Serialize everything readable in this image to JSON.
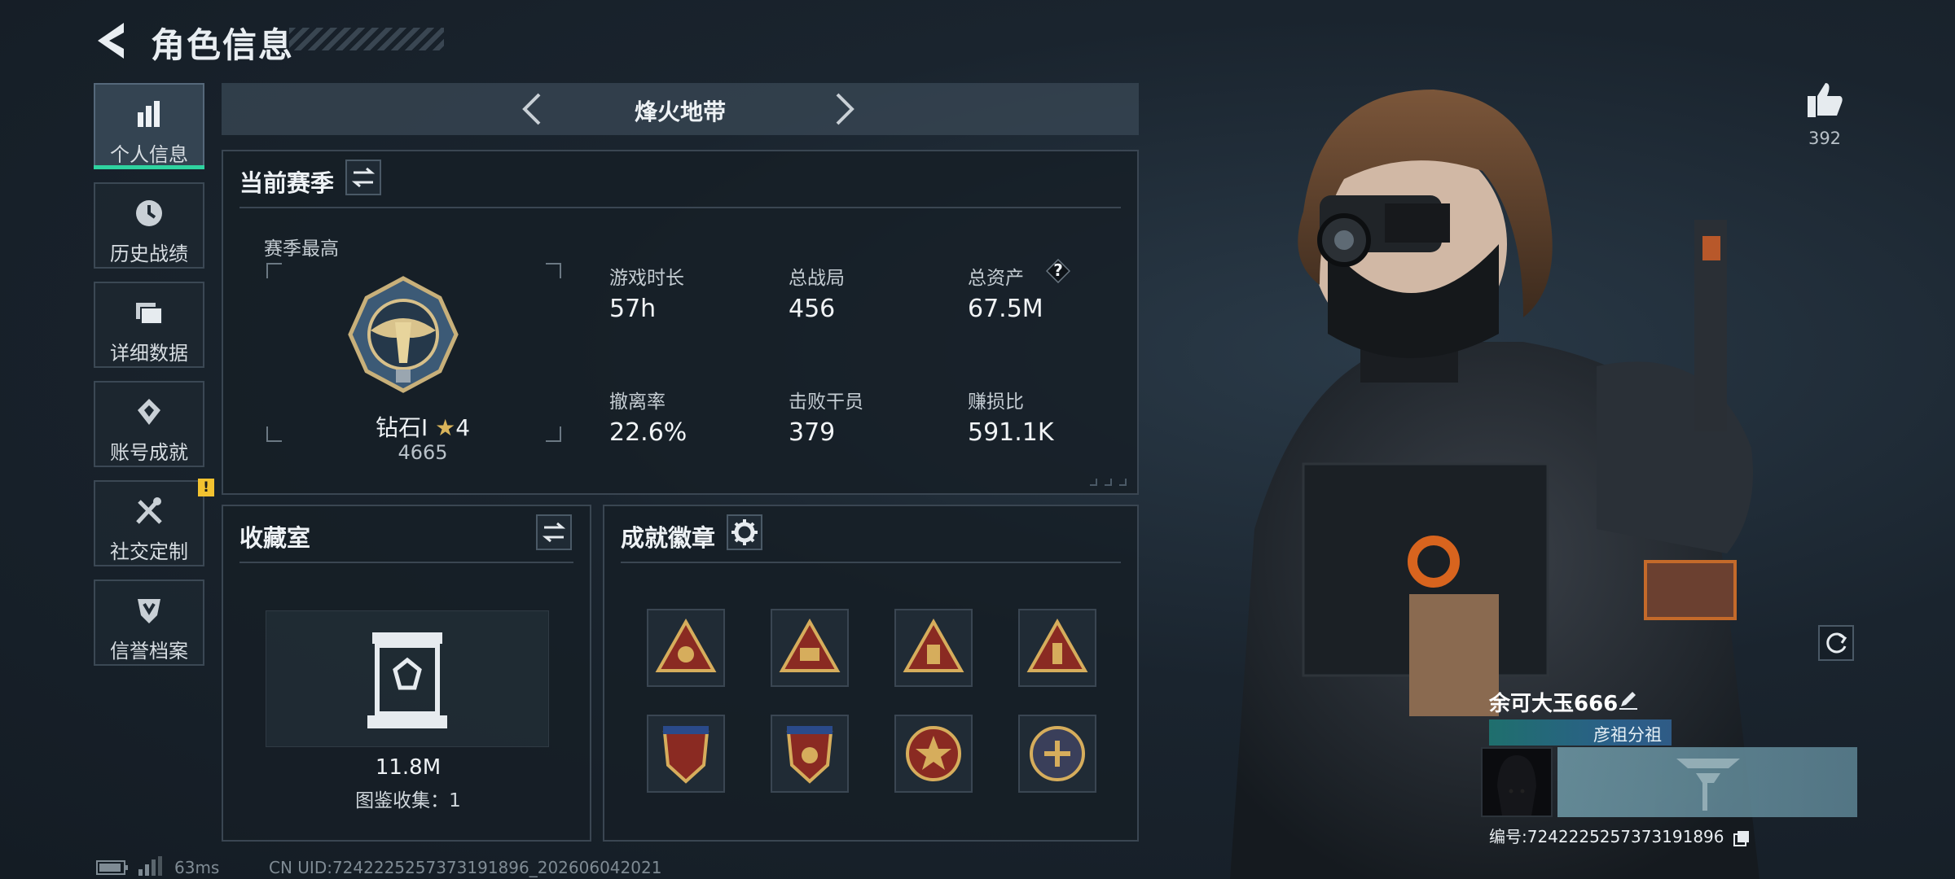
{
  "header": {
    "title": "角色信息"
  },
  "sidebar": {
    "items": [
      {
        "label": "个人信息",
        "icon": "bar-chart-icon",
        "active": true
      },
      {
        "label": "历史战绩",
        "icon": "history-clock-icon"
      },
      {
        "label": "详细数据",
        "icon": "folder-icon"
      },
      {
        "label": "账号成就",
        "icon": "achievement-icon"
      },
      {
        "label": "社交定制",
        "icon": "tools-icon",
        "badge": "!"
      },
      {
        "label": "信誉档案",
        "icon": "credit-shield-icon"
      }
    ]
  },
  "mode": {
    "title": "烽火地带"
  },
  "season": {
    "title": "当前赛季",
    "best_label": "赛季最高",
    "rank_name": "钻石Ⅰ",
    "rank_stars": "4",
    "rank_score": "4665",
    "stats": [
      {
        "label": "游戏时长",
        "value": "57h"
      },
      {
        "label": "总战局",
        "value": "456"
      },
      {
        "label": "总资产",
        "value": "67.5M",
        "help": "?"
      },
      {
        "label": "撤离率",
        "value": "22.6%"
      },
      {
        "label": "击败干员",
        "value": "379"
      },
      {
        "label": "赚损比",
        "value": "591.1K"
      }
    ]
  },
  "collection": {
    "title": "收藏室",
    "value": "11.8M",
    "catalog": "图鉴收集：1"
  },
  "achievements": {
    "title": "成就徽章",
    "badges": [
      "triangle-badge-icon",
      "triangle-badge-icon",
      "triangle-badge-icon",
      "triangle-badge-icon",
      "shield-badge-icon",
      "shield-badge-icon",
      "round-star-badge-icon",
      "round-star-badge-icon"
    ]
  },
  "profile": {
    "likes": "392",
    "name": "余可大玉666",
    "team": "彦祖分祖",
    "id_text": "编号:7242225257373191896"
  },
  "footer": {
    "ping": "63ms",
    "uid": "CN UID:7242225257373191896_202606042021"
  },
  "colors": {
    "accent": "#2fd3a0",
    "badge": "#f2c230",
    "panel_border": "#3a4652"
  }
}
